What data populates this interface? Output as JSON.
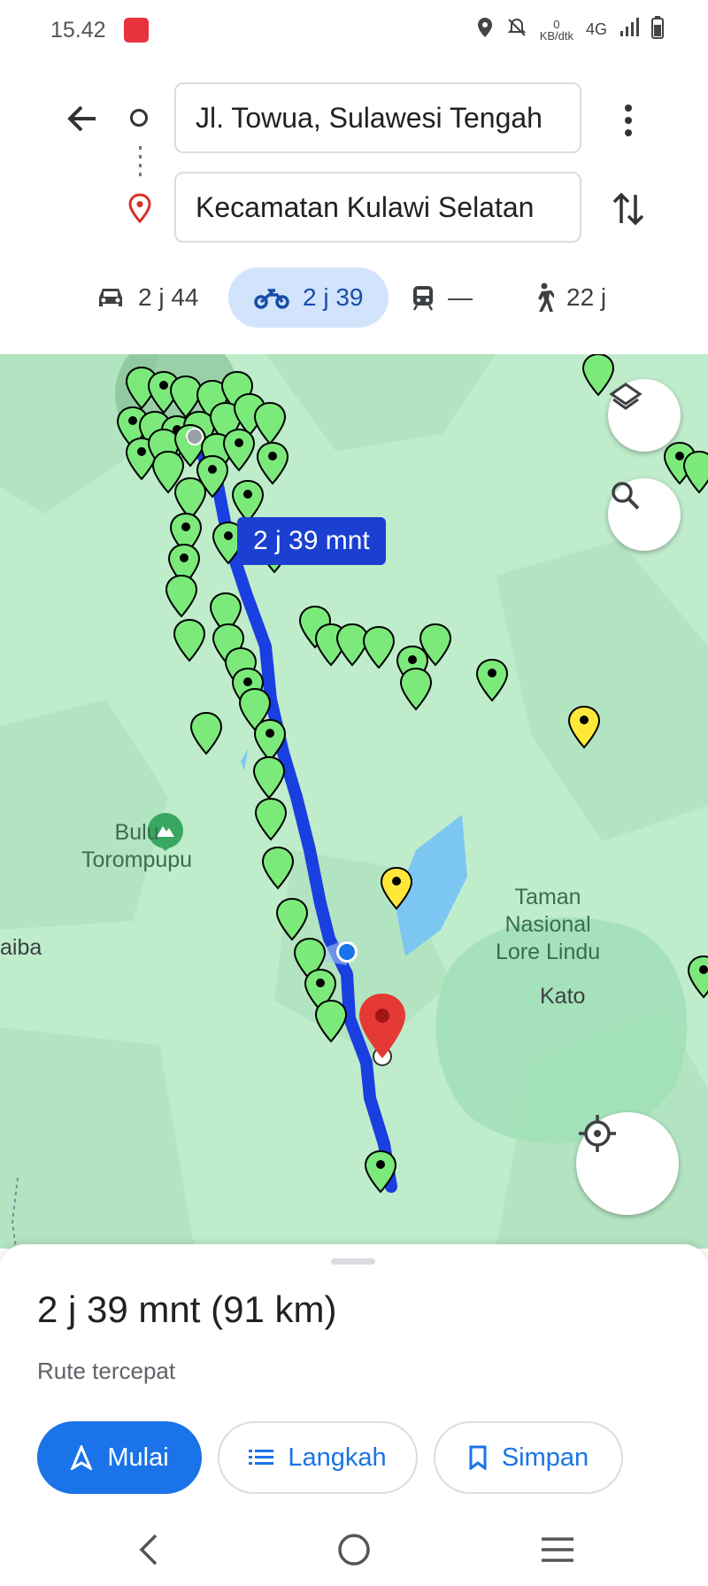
{
  "status_bar": {
    "time": "15.42",
    "net_speed_value": "0",
    "net_speed_unit": "KB/dtk",
    "network": "4G"
  },
  "header": {
    "origin": "Jl. Towua, Sulawesi Tengah",
    "destination": "Kecamatan Kulawi Selatan"
  },
  "modes": [
    {
      "icon": "car-icon",
      "label": "2 j 44"
    },
    {
      "icon": "motorcycle-icon",
      "label": "2 j 39",
      "active": true
    },
    {
      "icon": "transit-icon",
      "label": "—"
    },
    {
      "icon": "walk-icon",
      "label": "22 j"
    }
  ],
  "map": {
    "route_badge": "2 j 39 mnt",
    "labels": {
      "mountain_line1": "Bulu",
      "mountain_line2": "Torompupu",
      "park_line1": "Taman",
      "park_line2": "Nasional",
      "park_line3": "Lore Lindu",
      "town": "Kato",
      "edge_left": "aiba"
    },
    "colors": {
      "route": "#1a3fe0",
      "pin_green": "#7bea7b",
      "pin_yellow": "#ffe83a",
      "dest_pin": "#e53935"
    }
  },
  "sheet": {
    "summary": "2 j 39 mnt (91 km)",
    "subtitle": "Rute tercepat",
    "start": "Mulai",
    "steps": "Langkah",
    "save": "Simpan"
  }
}
